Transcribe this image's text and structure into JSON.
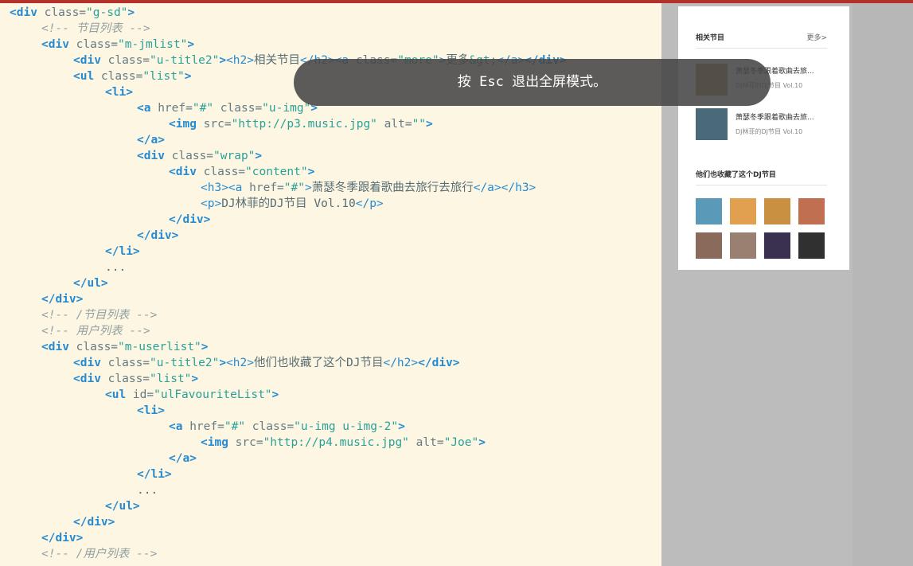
{
  "toast": {
    "text": "按 Esc 退出全屏模式。"
  },
  "code": {
    "lines": [
      [
        [
          "t",
          "<div"
        ],
        [
          "a",
          " class="
        ],
        [
          "s",
          "\"g-sd\""
        ],
        [
          "t",
          ">"
        ]
      ],
      [
        [
          "c",
          "<!-- 节目列表 -->"
        ]
      ],
      [
        [
          "t",
          "<div"
        ],
        [
          "a",
          " class="
        ],
        [
          "s",
          "\"m-jmlist\""
        ],
        [
          "t",
          ">"
        ]
      ],
      [
        [
          "t",
          "<div"
        ],
        [
          "a",
          " class="
        ],
        [
          "s",
          "\"u-title2\""
        ],
        [
          "t",
          ">"
        ],
        [
          "p",
          "<h2>"
        ],
        [
          "x",
          "相关节目"
        ],
        [
          "p",
          "</h2>"
        ],
        [
          "p",
          "<a"
        ],
        [
          "a",
          " class="
        ],
        [
          "s",
          "\"more\""
        ],
        [
          "p",
          ">"
        ],
        [
          "x",
          "更多"
        ],
        [
          "s",
          "&gt;"
        ],
        [
          "p",
          "</a>"
        ],
        [
          "t",
          "</div>"
        ]
      ],
      [
        [
          "t",
          "<ul"
        ],
        [
          "a",
          " class="
        ],
        [
          "s",
          "\"list\""
        ],
        [
          "t",
          ">"
        ]
      ],
      [
        [
          "t",
          "<li>"
        ]
      ],
      [
        [
          "t",
          "<a"
        ],
        [
          "a",
          " href="
        ],
        [
          "s",
          "\"#\""
        ],
        [
          "a",
          " class="
        ],
        [
          "s",
          "\"u-img\""
        ],
        [
          "t",
          ">"
        ]
      ],
      [
        [
          "t",
          "<img"
        ],
        [
          "a",
          " src="
        ],
        [
          "s",
          "\"http://p3.music.jpg\""
        ],
        [
          "a",
          " alt="
        ],
        [
          "s",
          "\"\""
        ],
        [
          "t",
          ">"
        ]
      ],
      [
        [
          "t",
          "</a>"
        ]
      ],
      [
        [
          "t",
          "<div"
        ],
        [
          "a",
          " class="
        ],
        [
          "s",
          "\"wrap\""
        ],
        [
          "t",
          ">"
        ]
      ],
      [
        [
          "t",
          "<div"
        ],
        [
          "a",
          " class="
        ],
        [
          "s",
          "\"content\""
        ],
        [
          "t",
          ">"
        ]
      ],
      [
        [
          "p",
          "<h3>"
        ],
        [
          "p",
          "<a"
        ],
        [
          "a",
          " href="
        ],
        [
          "s",
          "\"#\""
        ],
        [
          "p",
          ">"
        ],
        [
          "x",
          "萧瑟冬季跟着歌曲去旅行去旅行"
        ],
        [
          "p",
          "</a>"
        ],
        [
          "p",
          "</h3>"
        ]
      ],
      [
        [
          "p",
          "<p>"
        ],
        [
          "x",
          "DJ林菲的DJ节目 Vol.10"
        ],
        [
          "p",
          "</p>"
        ]
      ],
      [
        [
          "t",
          "</div>"
        ]
      ],
      [
        [
          "t",
          "</div>"
        ]
      ],
      [
        [
          "t",
          "</li>"
        ]
      ],
      [
        [
          "x",
          "..."
        ]
      ],
      [
        [
          "t",
          "</ul>"
        ]
      ],
      [
        [
          "t",
          "</div>"
        ]
      ],
      [
        [
          "c",
          "<!-- /节目列表 -->"
        ]
      ],
      [
        [
          "c",
          "<!-- 用户列表 -->"
        ]
      ],
      [
        [
          "t",
          "<div"
        ],
        [
          "a",
          " class="
        ],
        [
          "s",
          "\"m-userlist\""
        ],
        [
          "t",
          ">"
        ]
      ],
      [
        [
          "t",
          "<div"
        ],
        [
          "a",
          " class="
        ],
        [
          "s",
          "\"u-title2\""
        ],
        [
          "t",
          ">"
        ],
        [
          "p",
          "<h2>"
        ],
        [
          "x",
          "他们也收藏了这个DJ节目"
        ],
        [
          "p",
          "</h2>"
        ],
        [
          "t",
          "</div>"
        ]
      ],
      [
        [
          "t",
          "<div"
        ],
        [
          "a",
          " class="
        ],
        [
          "s",
          "\"list\""
        ],
        [
          "t",
          ">"
        ]
      ],
      [
        [
          "t",
          "<ul"
        ],
        [
          "a",
          " id="
        ],
        [
          "s",
          "\"ulFavouriteList\""
        ],
        [
          "t",
          ">"
        ]
      ],
      [
        [
          "t",
          "<li>"
        ]
      ],
      [
        [
          "t",
          "<a"
        ],
        [
          "a",
          " href="
        ],
        [
          "s",
          "\"#\""
        ],
        [
          "a",
          " class="
        ],
        [
          "s",
          "\"u-img u-img-2\""
        ],
        [
          "t",
          ">"
        ]
      ],
      [
        [
          "t",
          "<img"
        ],
        [
          "a",
          " src="
        ],
        [
          "s",
          "\"http://p4.music.jpg\""
        ],
        [
          "a",
          " alt="
        ],
        [
          "s",
          "\"Joe\""
        ],
        [
          "t",
          ">"
        ]
      ],
      [
        [
          "t",
          "</a>"
        ]
      ],
      [
        [
          "t",
          "</li>"
        ]
      ],
      [
        [
          "x",
          "..."
        ]
      ],
      [
        [
          "t",
          "</ul>"
        ]
      ],
      [
        [
          "t",
          "</div>"
        ]
      ],
      [
        [
          "t",
          "</div>"
        ]
      ],
      [
        [
          "c",
          "<!-- /用户列表 -->"
        ]
      ]
    ],
    "indents": [
      0,
      1,
      1,
      2,
      2,
      3,
      4,
      5,
      4,
      4,
      5,
      6,
      6,
      5,
      4,
      3,
      3,
      2,
      1,
      1,
      1,
      1,
      2,
      2,
      3,
      4,
      5,
      6,
      5,
      4,
      4,
      3,
      2,
      1,
      1
    ]
  },
  "preview": {
    "related_title": "相关节目",
    "more_label": "更多>",
    "items": [
      {
        "title": "萧瑟冬季跟着歌曲去旅...",
        "sub": "DJ林菲的DJ节目 Vol.10",
        "color": "#b88a5a"
      },
      {
        "title": "萧瑟冬季跟着歌曲去旅...",
        "sub": "DJ林菲的DJ节目 Vol.10",
        "color": "#4a6a7a"
      }
    ],
    "users_title": "他们也收藏了这个DJ节目",
    "avatars": [
      {
        "color": "#5a9ab8"
      },
      {
        "color": "#e0a050"
      },
      {
        "color": "#c89040"
      },
      {
        "color": "#c07050"
      },
      {
        "color": "#8a6a5a"
      },
      {
        "color": "#9a8070"
      },
      {
        "color": "#3a3050"
      },
      {
        "color": "#303030"
      }
    ]
  }
}
